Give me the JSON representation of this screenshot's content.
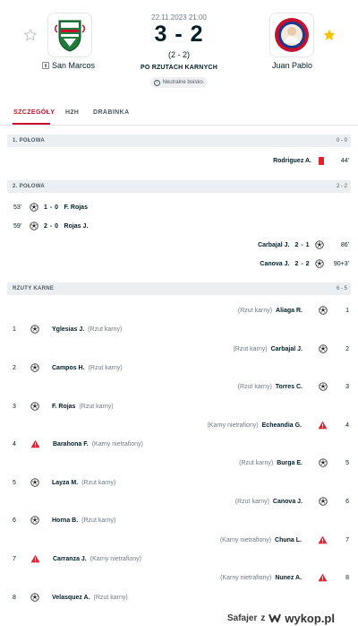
{
  "match": {
    "date": "22.11.2023 21:00",
    "score": "3 - 2",
    "score_sub": "(2 - 2)",
    "status": "PO RZUTACH KARNYCH",
    "neutral": "Neutralne boisko.",
    "home": {
      "name": "San Marcos",
      "logo_icon": "san-marcos-crest"
    },
    "away": {
      "name": "Juan Pablo",
      "logo_icon": "juan-pablo-crest"
    }
  },
  "tabs": [
    "SZCZEGÓŁY",
    "H2H",
    "DRABINKA"
  ],
  "first_half": {
    "title": "1. POŁOWA",
    "score": "0 - 0",
    "events": [
      {
        "side": "away",
        "player": "Rodriguez A.",
        "minute": "44'",
        "icon": "red-card-icon"
      }
    ]
  },
  "second_half": {
    "title": "2. POŁOWA",
    "score": "2 - 2",
    "events": [
      {
        "side": "home",
        "minute": "53'",
        "score": "1 - 0",
        "player": "F. Rojas",
        "icon": "ball-icon"
      },
      {
        "side": "home",
        "minute": "59'",
        "score": "2 - 0",
        "player": "Rojas J.",
        "icon": "ball-icon"
      },
      {
        "side": "away",
        "minute": "86'",
        "score": "2 - 1",
        "player": "Carbajal J.",
        "icon": "ball-icon"
      },
      {
        "side": "away",
        "minute": "90+3'",
        "score": "2 - 2",
        "player": "Canova J.",
        "icon": "ball-icon"
      }
    ]
  },
  "penalties": {
    "title": "RZUTY KARNE",
    "score": "6 - 5",
    "events": [
      {
        "side": "away",
        "num": "1",
        "player": "Aliaga R.",
        "note": "(Rzut karny)",
        "icon": "ball-icon"
      },
      {
        "side": "home",
        "num": "1",
        "player": "Yglesias J.",
        "note": "(Rzut karny)",
        "icon": "ball-icon"
      },
      {
        "side": "away",
        "num": "2",
        "player": "Carbajal J.",
        "note": "(Rzut karny)",
        "icon": "ball-icon"
      },
      {
        "side": "home",
        "num": "2",
        "player": "Campos H.",
        "note": "(Rzut karny)",
        "icon": "ball-icon"
      },
      {
        "side": "away",
        "num": "3",
        "player": "Torres C.",
        "note": "(Rzut karny)",
        "icon": "ball-icon"
      },
      {
        "side": "home",
        "num": "3",
        "player": "F. Rojas",
        "note": "(Rzut karny)",
        "icon": "ball-icon"
      },
      {
        "side": "away",
        "num": "4",
        "player": "Echeandia G.",
        "note": "(Karny nietrafiony)",
        "icon": "missed-icon"
      },
      {
        "side": "home",
        "num": "4",
        "player": "Barahona F.",
        "note": "(Karny nietrafiony)",
        "icon": "missed-icon"
      },
      {
        "side": "away",
        "num": "5",
        "player": "Burga E.",
        "note": "(Rzut karny)",
        "icon": "ball-icon"
      },
      {
        "side": "home",
        "num": "5",
        "player": "Layza M.",
        "note": "(Rzut karny)",
        "icon": "ball-icon"
      },
      {
        "side": "away",
        "num": "6",
        "player": "Canova J.",
        "note": "(Rzut karny)",
        "icon": "ball-icon"
      },
      {
        "side": "home",
        "num": "6",
        "player": "Horna B.",
        "note": "(Rzut karny)",
        "icon": "ball-icon"
      },
      {
        "side": "away",
        "num": "7",
        "player": "Chuna L.",
        "note": "(Karny nietrafiony)",
        "icon": "missed-icon"
      },
      {
        "side": "home",
        "num": "7",
        "player": "Carranza J.",
        "note": "(Karny nietrafiony)",
        "icon": "missed-icon"
      },
      {
        "side": "away",
        "num": "8",
        "player": "Nunez A.",
        "note": "(Karny nietrafiony)",
        "icon": "missed-icon"
      },
      {
        "side": "home",
        "num": "8",
        "player": "Velasquez A.",
        "note": "(Rzut karny)",
        "icon": "ball-icon"
      }
    ]
  },
  "watermark": {
    "user": "Safajer",
    "z": "z",
    "site": "wykop.pl"
  },
  "colors": {
    "accent": "#c8102e",
    "star": "#f5c400",
    "missed": "#e0212f",
    "section_bg": "#eceff1"
  }
}
